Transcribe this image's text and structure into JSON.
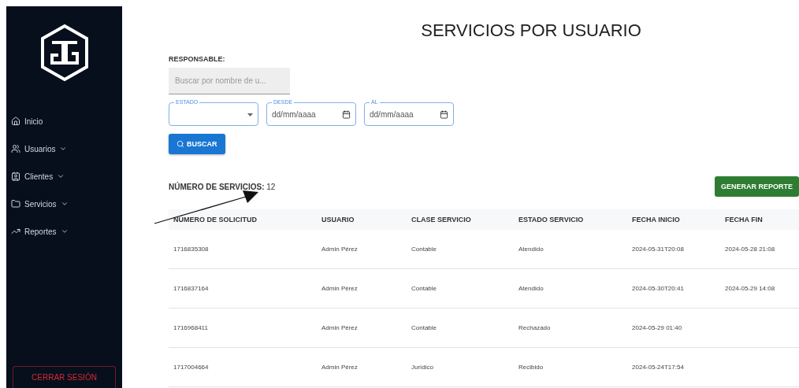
{
  "sidebar": {
    "items": [
      {
        "label": "Inicio",
        "expandable": false
      },
      {
        "label": "Usuarios",
        "expandable": true
      },
      {
        "label": "Clientes",
        "expandable": true
      },
      {
        "label": "Servicios",
        "expandable": true
      },
      {
        "label": "Reportes",
        "expandable": true
      }
    ],
    "logout": "CERRAR SESIÓN"
  },
  "title": "SERVICIOS POR USUARIO",
  "filters": {
    "responsable_label": "RESPONSABLE:",
    "search": {
      "placeholder": "Buscar por nombre de u..."
    },
    "estado": {
      "label": "ESTADO"
    },
    "desde": {
      "label": "DESDE",
      "placeholder": "dd/mm/aaaa"
    },
    "al": {
      "label": "AL",
      "placeholder": "dd/mm/aaaa"
    },
    "search_button": "BUSCAR"
  },
  "count": {
    "label": "NÚMERO DE SERVICIOS:",
    "value": "12"
  },
  "report_button": "GENERAR REPORTE",
  "table": {
    "columns": [
      "NÚMERO DE SOLICITUD",
      "USUARIO",
      "CLASE SERVICIO",
      "ESTADO SERVICIO",
      "FECHA INICIO",
      "FECHA FIN"
    ],
    "rows": [
      [
        "1716835308",
        "Admin Pérez",
        "Contable",
        "Atendido",
        "2024-05-31T20:08",
        "2024-05-28 21:08"
      ],
      [
        "1716837164",
        "Admin Pérez",
        "Contable",
        "Atendido",
        "2024-05-30T20:41",
        "2024-05-29 14:08"
      ],
      [
        "1716968411",
        "Admin Pérez",
        "Contable",
        "Rechazado",
        "2024-05-29 01:40"
      ],
      [
        "1717004664",
        "Admin Pérez",
        "Jurídico",
        "Recibido",
        "2024-05-24T17:54"
      ]
    ]
  }
}
